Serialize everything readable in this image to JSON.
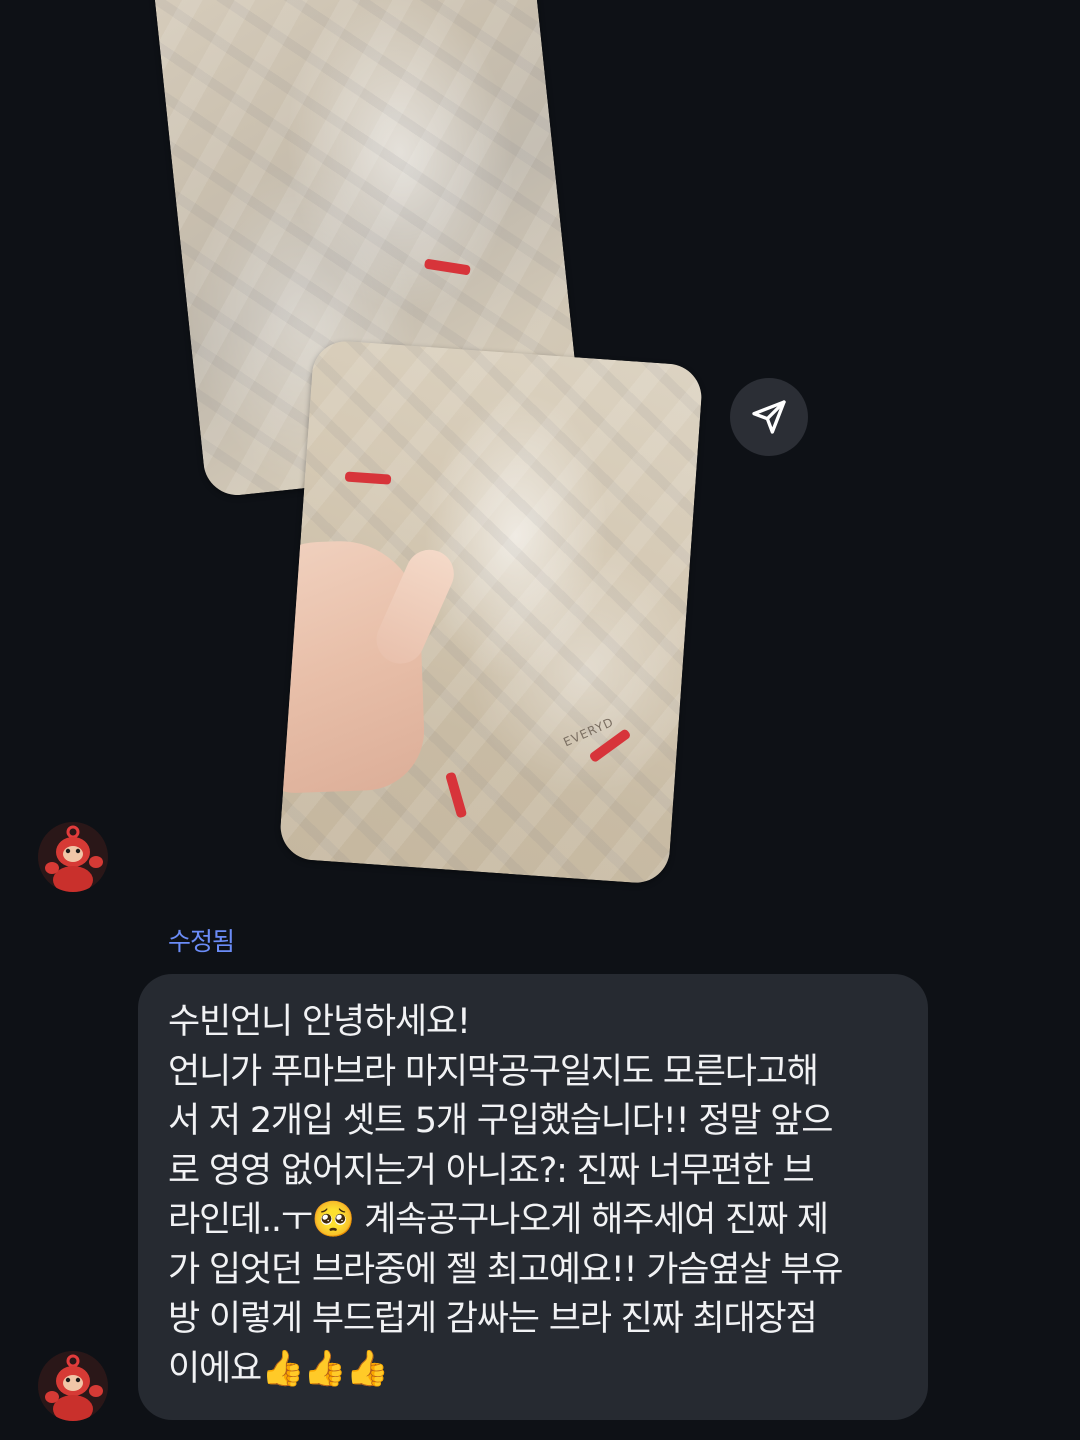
{
  "message": {
    "edited_label": "수정됨",
    "lines": [
      "수빈언니 안녕하세요!",
      "언니가 푸마브라 마지막공구일지도 모른다고해",
      "서 저 2개입 셋트 5개 구입했습니다!! 정말 앞으",
      "로 영영 없어지는거 아니죠?: 진짜 너무편한 브",
      "라인데..ㅜ🥺 계속공구나오게 해주세여 진짜 제",
      "가 입엇던 브라중에 젤 최고예요!! 가슴옆살 부유",
      "방 이렇게 부드럽게 감싸는 브라 진짜 최대장점",
      "이에요👍👍👍"
    ]
  },
  "photos": {
    "front_brand_text": "EVERYD"
  },
  "icons": {
    "share": "send-icon",
    "avatar": "avatar-icon"
  },
  "colors": {
    "background": "#0e1116",
    "bubble": "#262a31",
    "edited_label": "#6b8cf7",
    "share_button": "#2b2e35"
  }
}
